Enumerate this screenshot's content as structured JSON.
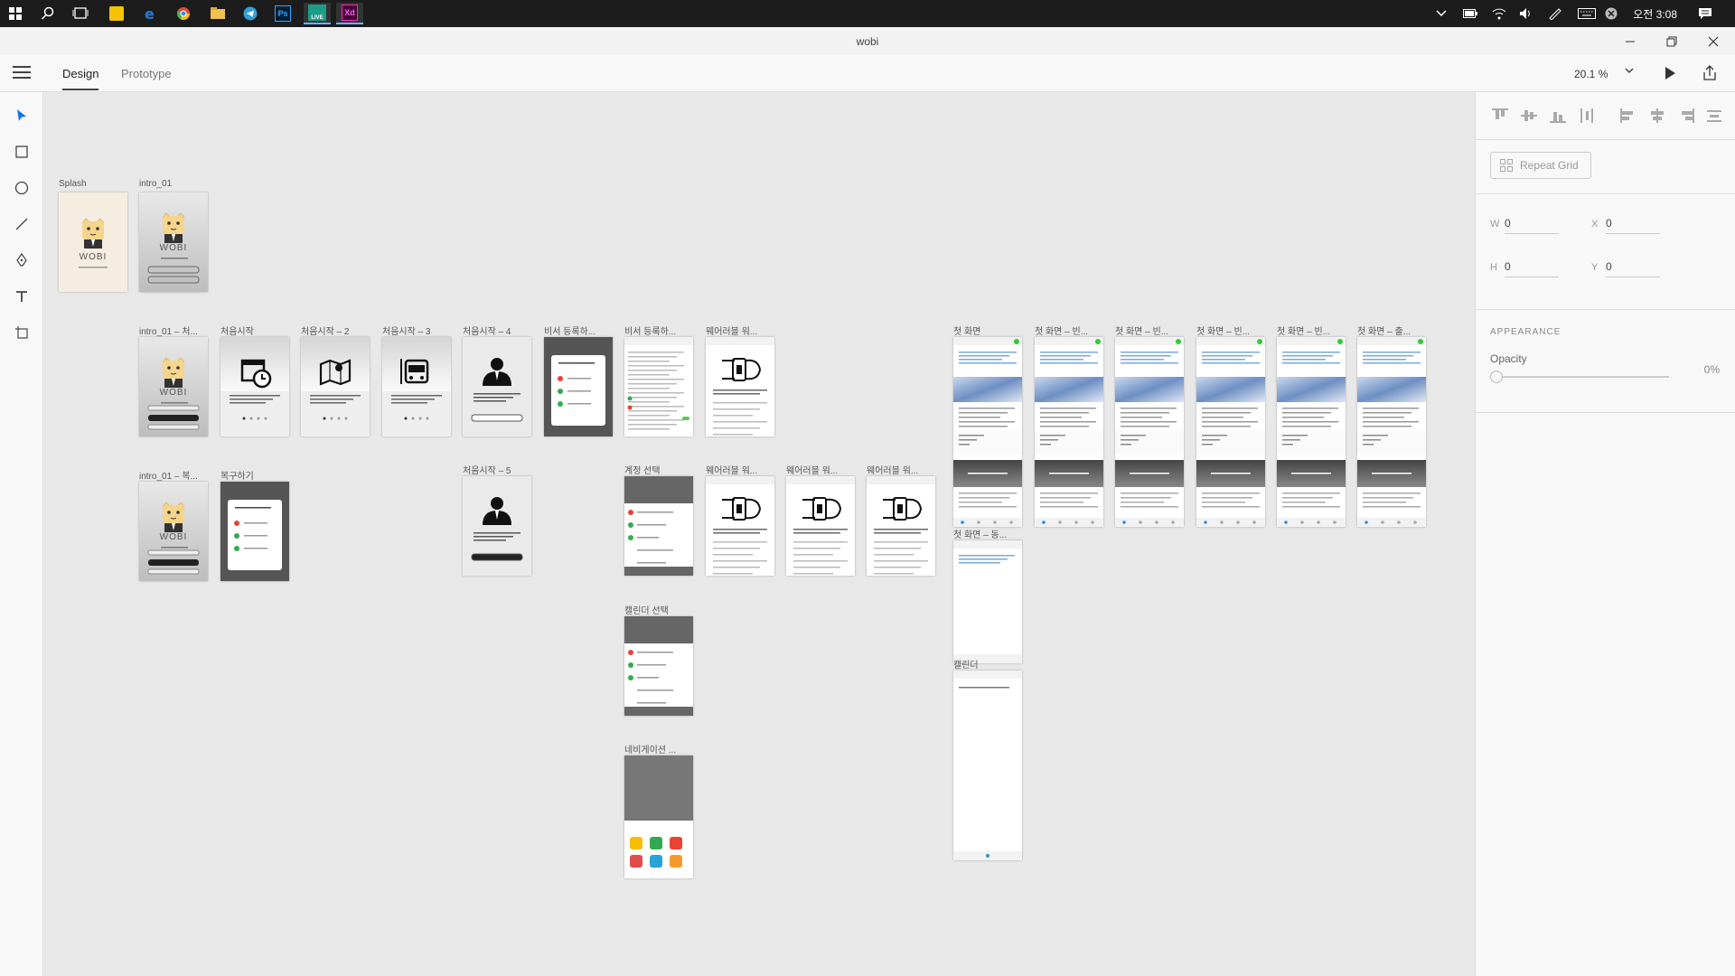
{
  "taskbar": {
    "apps": [
      {
        "icon": "start-windows-icon"
      },
      {
        "icon": "search-icon"
      },
      {
        "icon": "task-view-icon"
      },
      {
        "icon": "sticky-notes-icon",
        "color": "#f4c400"
      },
      {
        "icon": "edge-browser-icon",
        "color": "#1e7de0"
      },
      {
        "icon": "chrome-icon",
        "color": "#dd4b39"
      },
      {
        "icon": "file-explorer-icon",
        "color": "#f2c14e"
      },
      {
        "icon": "telegram-icon",
        "color": "#2fa0db"
      },
      {
        "icon": "photoshop-icon",
        "label": "Ps",
        "color": "#31a8ff"
      },
      {
        "icon": "live-app-icon",
        "label": "LIVE",
        "color": "#1a9e86"
      },
      {
        "icon": "adobe-xd-icon",
        "label": "Xd",
        "color": "#ff2bc2"
      }
    ],
    "clock": "오전 3:08"
  },
  "window": {
    "title": "wobi"
  },
  "header": {
    "tabs": [
      {
        "label": "Design",
        "active": true
      },
      {
        "label": "Prototype",
        "active": false
      }
    ],
    "zoom": "20.1 %"
  },
  "tools": [
    "select-tool-icon",
    "rectangle-tool-icon",
    "ellipse-tool-icon",
    "line-tool-icon",
    "pen-tool-icon",
    "text-tool-icon",
    "artboard-tool-icon"
  ],
  "artboards": [
    {
      "id": "splash",
      "label": "Splash",
      "kind": "splash"
    },
    {
      "id": "intro01",
      "label": "intro_01",
      "kind": "intro"
    },
    {
      "id": "intro01-start",
      "label": "intro_01 – 처...",
      "kind": "intro-dark"
    },
    {
      "id": "start1",
      "label": "처음시작",
      "kind": "onboard",
      "icon": "calendar-clock-icon"
    },
    {
      "id": "start2",
      "label": "처음시작 – 2",
      "kind": "onboard",
      "icon": "map-icon"
    },
    {
      "id": "start3",
      "label": "처음시작 – 3",
      "kind": "onboard",
      "icon": "bus-icon"
    },
    {
      "id": "start4",
      "label": "처음시작 – 4",
      "kind": "person",
      "icon": "businessman-icon"
    },
    {
      "id": "secretary1",
      "label": "비서 등록하...",
      "kind": "dialog"
    },
    {
      "id": "secretary2",
      "label": "비서 등록하...",
      "kind": "list"
    },
    {
      "id": "wearable1",
      "label": "웨어러블 워...",
      "kind": "wearable",
      "icon": "smartwatch-icon"
    },
    {
      "id": "intro01-restore",
      "label": "intro_01 – 복...",
      "kind": "intro-dark"
    },
    {
      "id": "restore",
      "label": "복구하기",
      "kind": "dialog"
    },
    {
      "id": "start5",
      "label": "처음시작 – 5",
      "kind": "person",
      "icon": "businessman-icon"
    },
    {
      "id": "account",
      "label": "계정 선택",
      "kind": "account"
    },
    {
      "id": "wearable2",
      "label": "웨어러블 워...",
      "kind": "wearable",
      "icon": "smartwatch-icon"
    },
    {
      "id": "wearable3",
      "label": "웨어러블 워...",
      "kind": "wearable",
      "icon": "smartwatch-icon"
    },
    {
      "id": "wearable4",
      "label": "웨어러블 워...",
      "kind": "wearable",
      "icon": "smartwatch-icon"
    },
    {
      "id": "calendar-select",
      "label": "캘린더 선택",
      "kind": "account"
    },
    {
      "id": "navigation",
      "label": "네비게이션 ...",
      "kind": "nav-apps"
    },
    {
      "id": "home",
      "label": "첫 화면",
      "kind": "home"
    },
    {
      "id": "home-b1",
      "label": "첫 화면 – 빈...",
      "kind": "home"
    },
    {
      "id": "home-b2",
      "label": "첫 화면 – 빈...",
      "kind": "home"
    },
    {
      "id": "home-b3",
      "label": "첫 화면 – 빈...",
      "kind": "home"
    },
    {
      "id": "home-b4",
      "label": "첫 화면 – 빈...",
      "kind": "home"
    },
    {
      "id": "home-out",
      "label": "첫 화면 – 출...",
      "kind": "home"
    },
    {
      "id": "home-sync",
      "label": "첫 화면 – 동...",
      "kind": "blank"
    },
    {
      "id": "calendar",
      "label": "캘린더",
      "kind": "blank-list"
    }
  ],
  "inspector": {
    "repeat_grid": "Repeat Grid",
    "w_label": "W",
    "w_value": "0",
    "x_label": "X",
    "x_value": "0",
    "h_label": "H",
    "h_value": "0",
    "y_label": "Y",
    "y_value": "0",
    "appearance": "APPEARANCE",
    "opacity_label": "Opacity",
    "opacity_value": "0%"
  }
}
